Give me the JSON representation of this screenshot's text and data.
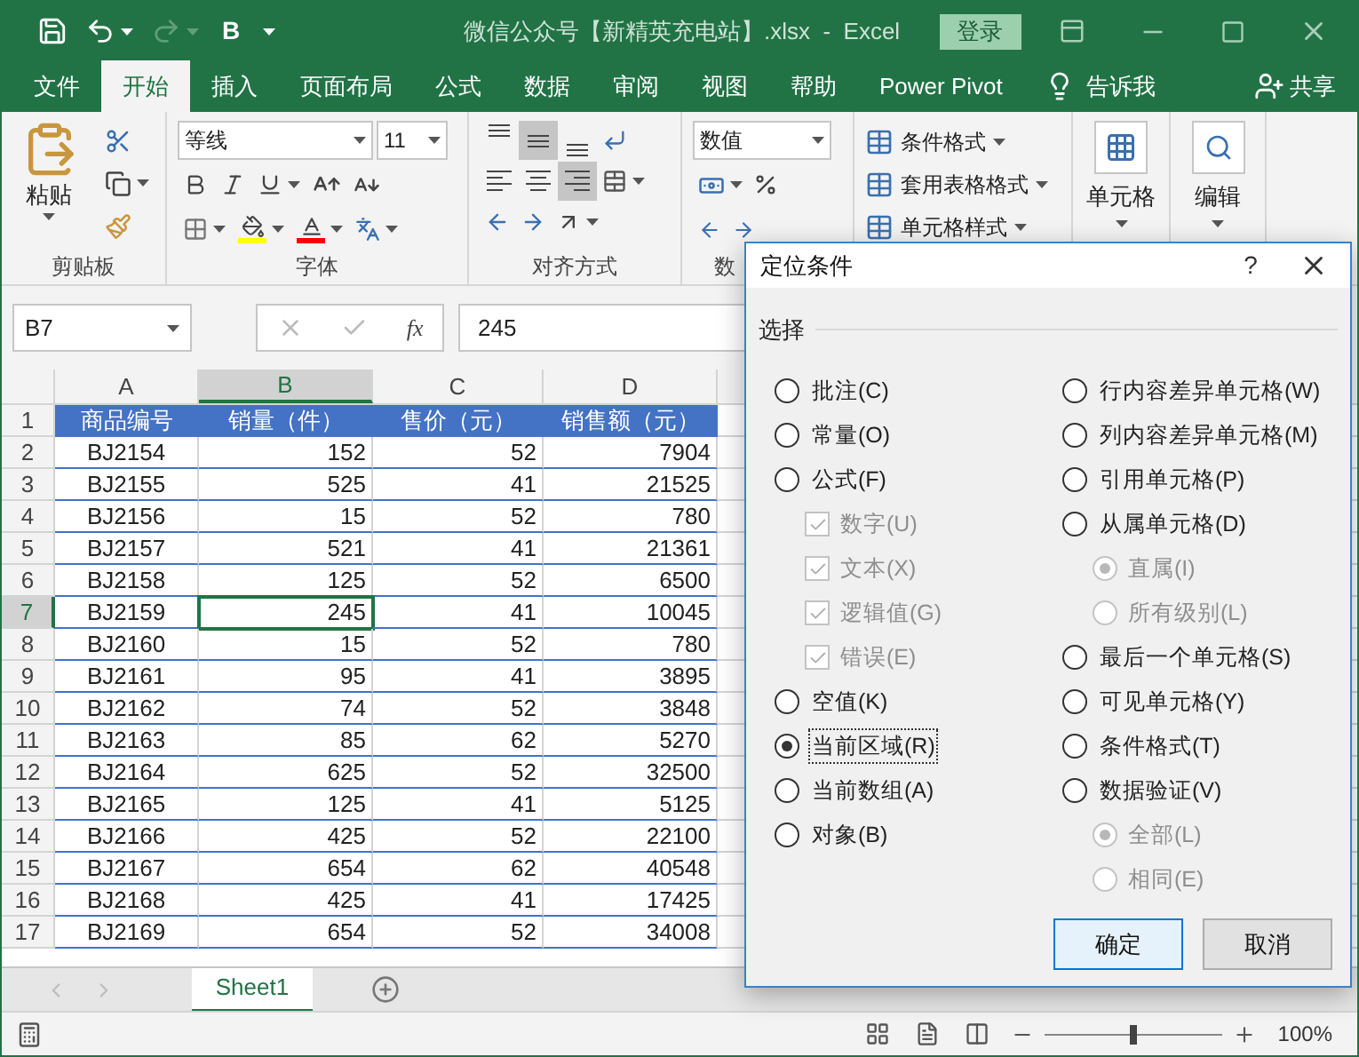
{
  "title_bar": {
    "quick_access_label": "B",
    "title": "微信公众号【新精英充电站】.xlsx  -  Excel",
    "login_button": "登录"
  },
  "tabs": [
    {
      "label": "文件",
      "selected": false
    },
    {
      "label": "开始",
      "selected": true
    },
    {
      "label": "插入",
      "selected": false
    },
    {
      "label": "页面布局",
      "selected": false
    },
    {
      "label": "公式",
      "selected": false
    },
    {
      "label": "数据",
      "selected": false
    },
    {
      "label": "审阅",
      "selected": false
    },
    {
      "label": "视图",
      "selected": false
    },
    {
      "label": "帮助",
      "selected": false
    },
    {
      "label": "Power Pivot",
      "selected": false
    }
  ],
  "tell_me": "告诉我",
  "share": "共享",
  "ribbon": {
    "clipboard": {
      "paste": "粘贴",
      "label": "剪贴板"
    },
    "font": {
      "font_name": "等线",
      "font_size": "11",
      "label": "字体"
    },
    "alignment": {
      "vertical_buttons": [
        {
          "kind": "top",
          "selected": false
        },
        {
          "kind": "middle",
          "selected": true
        },
        {
          "kind": "bottom",
          "selected": false
        }
      ],
      "horizontal_buttons": [
        {
          "kind": "left",
          "selected": false
        },
        {
          "kind": "center",
          "selected": false
        },
        {
          "kind": "right",
          "selected": true
        }
      ],
      "label": "对齐方式"
    },
    "number": {
      "format": "数值",
      "label": "数"
    },
    "styles": {
      "items": [
        "条件格式",
        "套用表格格式",
        "单元格样式"
      ]
    },
    "cells": {
      "label": "单元格"
    },
    "editing": {
      "label": "编辑"
    }
  },
  "formula_bar": {
    "name_box": "B7",
    "function_label": "fx",
    "value": "245"
  },
  "sheet": {
    "columns": [
      {
        "label": "A",
        "selected": false
      },
      {
        "label": "B",
        "selected": true
      },
      {
        "label": "C",
        "selected": false
      },
      {
        "label": "D",
        "selected": false
      }
    ],
    "rows": [
      {
        "number": "1",
        "selected": false,
        "kind": "header",
        "cells": [
          "商品编号",
          "销量（件）",
          "售价（元）",
          "销售额（元）"
        ]
      },
      {
        "number": "2",
        "selected": false,
        "kind": "data",
        "cells": [
          "BJ2154",
          "152",
          "52",
          "7904"
        ]
      },
      {
        "number": "3",
        "selected": false,
        "kind": "data",
        "cells": [
          "BJ2155",
          "525",
          "41",
          "21525"
        ]
      },
      {
        "number": "4",
        "selected": false,
        "kind": "data",
        "cells": [
          "BJ2156",
          "15",
          "52",
          "780"
        ]
      },
      {
        "number": "5",
        "selected": false,
        "kind": "data",
        "cells": [
          "BJ2157",
          "521",
          "41",
          "21361"
        ]
      },
      {
        "number": "6",
        "selected": false,
        "kind": "data",
        "cells": [
          "BJ2158",
          "125",
          "52",
          "6500"
        ]
      },
      {
        "number": "7",
        "selected": true,
        "kind": "data",
        "cells": [
          "BJ2159",
          "245",
          "41",
          "10045"
        ]
      },
      {
        "number": "8",
        "selected": false,
        "kind": "data",
        "cells": [
          "BJ2160",
          "15",
          "52",
          "780"
        ]
      },
      {
        "number": "9",
        "selected": false,
        "kind": "data",
        "cells": [
          "BJ2161",
          "95",
          "41",
          "3895"
        ]
      },
      {
        "number": "10",
        "selected": false,
        "kind": "data",
        "cells": [
          "BJ2162",
          "74",
          "52",
          "3848"
        ]
      },
      {
        "number": "11",
        "selected": false,
        "kind": "data",
        "cells": [
          "BJ2163",
          "85",
          "62",
          "5270"
        ]
      },
      {
        "number": "12",
        "selected": false,
        "kind": "data",
        "cells": [
          "BJ2164",
          "625",
          "52",
          "32500"
        ]
      },
      {
        "number": "13",
        "selected": false,
        "kind": "data",
        "cells": [
          "BJ2165",
          "125",
          "41",
          "5125"
        ]
      },
      {
        "number": "14",
        "selected": false,
        "kind": "data",
        "cells": [
          "BJ2166",
          "425",
          "52",
          "22100"
        ]
      },
      {
        "number": "15",
        "selected": false,
        "kind": "data",
        "cells": [
          "BJ2167",
          "654",
          "62",
          "40548"
        ]
      },
      {
        "number": "16",
        "selected": false,
        "kind": "data",
        "cells": [
          "BJ2168",
          "425",
          "41",
          "17425"
        ]
      },
      {
        "number": "17",
        "selected": false,
        "kind": "data",
        "cells": [
          "BJ2169",
          "654",
          "52",
          "34008"
        ]
      }
    ]
  },
  "sheet_tabs": [
    {
      "label": "Sheet1",
      "selected": true
    }
  ],
  "status_bar": {
    "zoom": "100%",
    "level": 0.5
  },
  "dialog": {
    "title": "定位条件",
    "help": "?",
    "section": "选择",
    "left_options": [
      {
        "label": "批注(C)",
        "selected": false
      },
      {
        "label": "常量(O)",
        "selected": false
      },
      {
        "label": "公式(F)",
        "selected": false,
        "children": [
          {
            "kind": "checkbox",
            "label": "数字(U)",
            "checked": true,
            "disabled": true
          },
          {
            "kind": "checkbox",
            "label": "文本(X)",
            "checked": true,
            "disabled": true
          },
          {
            "kind": "checkbox",
            "label": "逻辑值(G)",
            "checked": true,
            "disabled": true
          },
          {
            "kind": "checkbox",
            "label": "错误(E)",
            "checked": true,
            "disabled": true
          }
        ]
      },
      {
        "label": "空值(K)",
        "selected": false
      },
      {
        "label": "当前区域(R)",
        "selected": true
      },
      {
        "label": "当前数组(A)",
        "selected": false
      },
      {
        "label": "对象(B)",
        "selected": false
      }
    ],
    "right_options": [
      {
        "label": "行内容差异单元格(W)",
        "selected": false
      },
      {
        "label": "列内容差异单元格(M)",
        "selected": false
      },
      {
        "label": "引用单元格(P)",
        "selected": false
      },
      {
        "label": "从属单元格(D)",
        "selected": false,
        "children": [
          {
            "kind": "radio",
            "label": "直属(I)",
            "selected": true,
            "disabled": true
          },
          {
            "kind": "radio",
            "label": "所有级别(L)",
            "selected": false,
            "disabled": true
          }
        ]
      },
      {
        "label": "最后一个单元格(S)",
        "selected": false
      },
      {
        "label": "可见单元格(Y)",
        "selected": false
      },
      {
        "label": "条件格式(T)",
        "selected": false
      },
      {
        "label": "数据验证(V)",
        "selected": false,
        "children": [
          {
            "kind": "radio",
            "label": "全部(L)",
            "selected": true,
            "disabled": true
          },
          {
            "kind": "radio",
            "label": "相同(E)",
            "selected": false,
            "disabled": true
          }
        ]
      }
    ],
    "ok_button": "确定",
    "cancel_button": "取消"
  }
}
